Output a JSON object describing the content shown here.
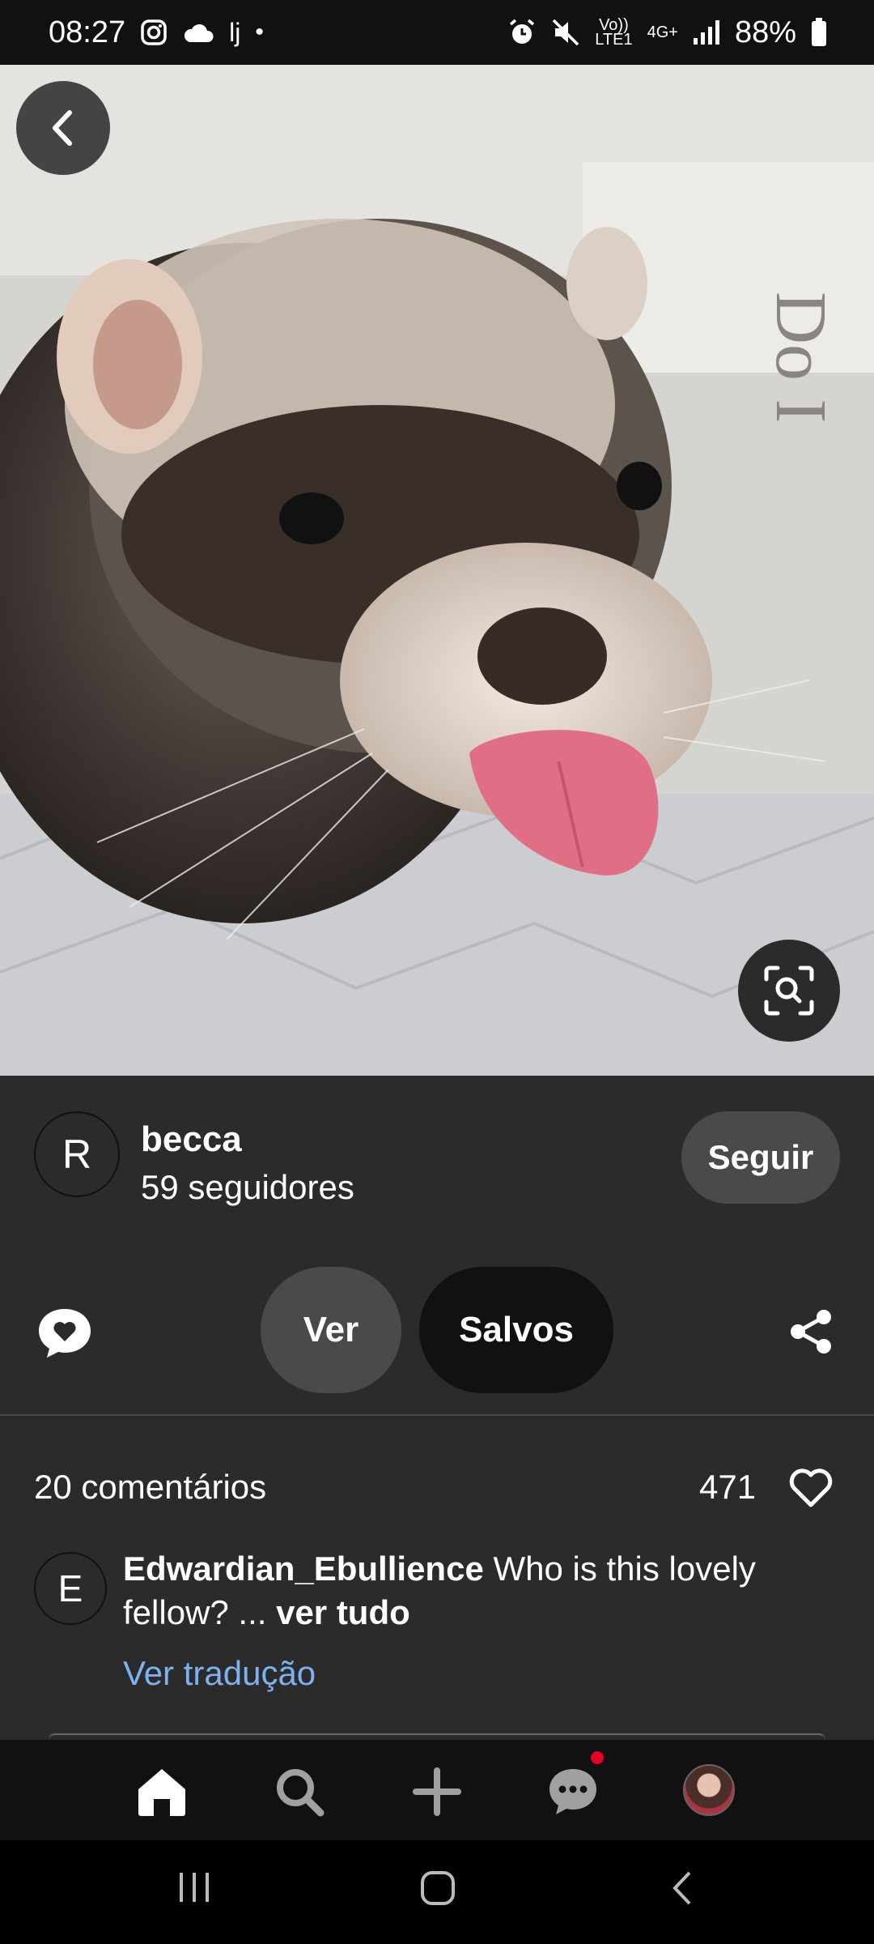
{
  "status_bar": {
    "time": "08:27",
    "lj": "lj",
    "dot": "•",
    "volte": "Vo))\nLTE1",
    "network": "4G+",
    "battery": "88%",
    "icons": [
      "instagram-icon",
      "cloud-icon",
      "alarm-icon",
      "mute-icon",
      "signal-icon",
      "battery-icon"
    ]
  },
  "pin": {
    "image_icon": "ferret-photo",
    "back_icon": "back-arrow-icon",
    "lens_icon": "visual-search-icon"
  },
  "author": {
    "initial": "R",
    "name": "becca",
    "followers": "59 seguidores",
    "follow_label": "Seguir"
  },
  "actions": {
    "ver_label": "Ver",
    "salvos_label": "Salvos"
  },
  "comments": {
    "count_label": "20 comentários",
    "likes": "471",
    "items": [
      {
        "initial": "E",
        "author": "Edwardian_Ebullience",
        "text": "Who is this lovely fellow? ...",
        "more": "ver tudo",
        "translate": "Ver tradução"
      }
    ]
  },
  "nav": {
    "items": [
      "home-icon",
      "search-icon",
      "create-icon",
      "messages-icon",
      "profile-avatar"
    ],
    "accent": "#e60023"
  }
}
